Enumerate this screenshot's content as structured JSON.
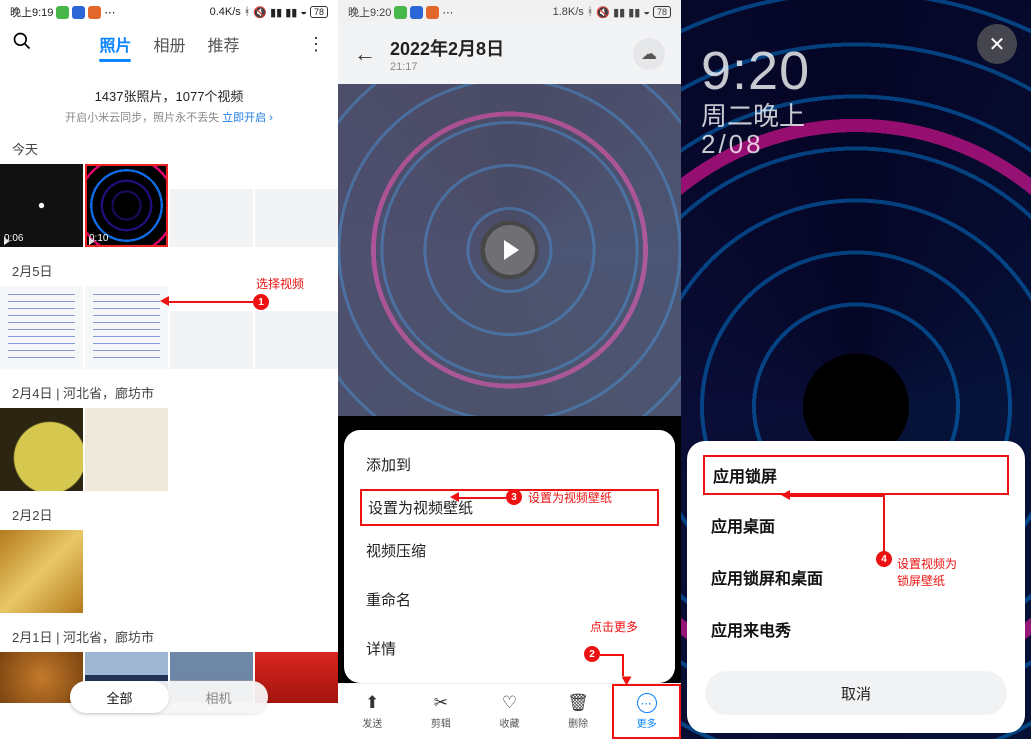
{
  "status1": {
    "time_label": "晚上9:19",
    "net_label": "0.4K/s",
    "battery": "78"
  },
  "status2": {
    "time_label": "晚上9:20",
    "net_label": "1.8K/s",
    "battery": "78"
  },
  "gallery": {
    "tabs": {
      "photos": "照片",
      "albums": "相册",
      "recommend": "推荐"
    },
    "counts_text": "1437张照片，1077个视频",
    "sync_hint": "开启小米云同步，照片永不丢失",
    "sync_link": "立即开启",
    "sections": {
      "today": "今天",
      "feb5": "2月5日",
      "feb4": "2月4日 | 河北省，廊坊市",
      "feb2": "2月2日",
      "feb1": "2月1日 | 河北省，廊坊市"
    },
    "durations": {
      "v1": "0:06",
      "v2": "0:10"
    },
    "bottom_tabs": {
      "all": "全部",
      "camera": "相机"
    }
  },
  "annotations": {
    "n1": "1",
    "t1": "选择视频",
    "n2": "2",
    "t2": "点击更多",
    "n3": "3",
    "t3": "设置为视频壁纸",
    "n4": "4",
    "t4a": "设置视频为",
    "t4b": "锁屏壁纸"
  },
  "detail": {
    "title": "2022年2月8日",
    "time": "21:17",
    "menu": {
      "add_to": "添加到",
      "set_video_wallpaper": "设置为视频壁纸",
      "compress": "视频压缩",
      "rename": "重命名",
      "info": "详情"
    },
    "toolbar": {
      "send": "发送",
      "cut": "剪辑",
      "fav": "收藏",
      "del": "删除",
      "more": "更多"
    }
  },
  "apply": {
    "lock_time": "9:20",
    "lock_line2": "周二晚上",
    "lock_line3": "2/08",
    "options": {
      "lock": "应用锁屏",
      "home": "应用桌面",
      "both": "应用锁屏和桌面",
      "callshow": "应用来电秀"
    },
    "cancel": "取消"
  }
}
